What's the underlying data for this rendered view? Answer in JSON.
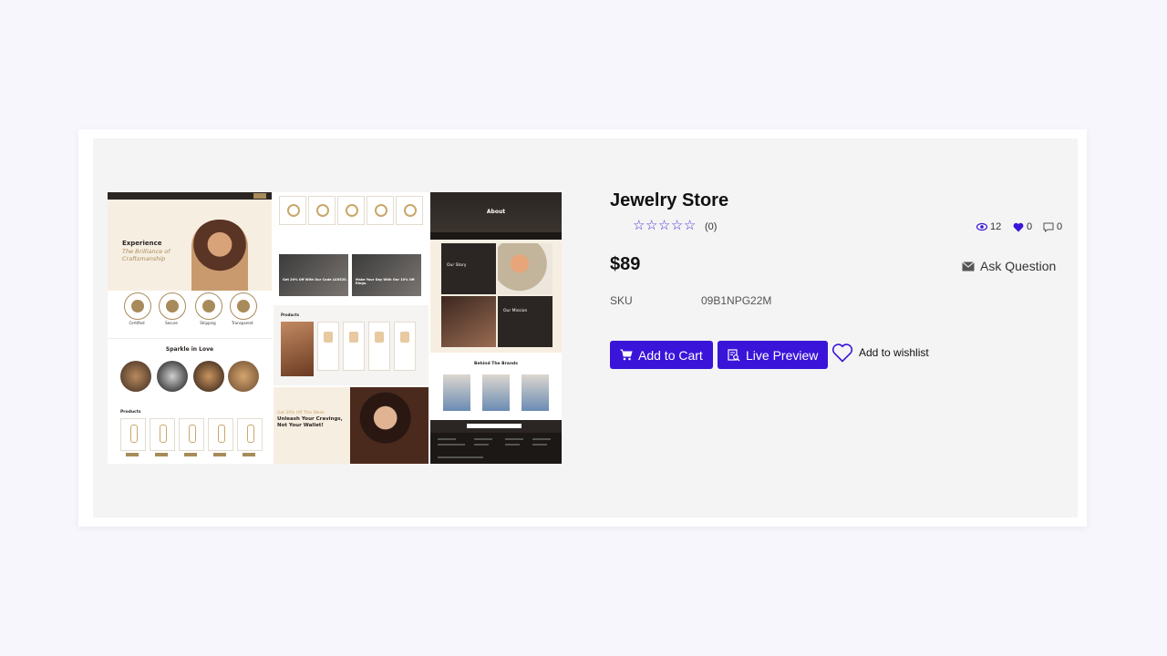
{
  "product": {
    "title": "Jewelry Store",
    "rating_count": "(0)",
    "views": "12",
    "likes": "0",
    "comments": "0",
    "price": "$89",
    "ask_label": "Ask Question",
    "sku_label": "SKU",
    "sku_value": "09B1NPG22M",
    "add_to_cart": "Add to Cart",
    "live_preview": "Live Preview",
    "wishlist": "Add to wishlist"
  },
  "preview": {
    "hero_title": "Experience",
    "hero_sub": "The Brilliance of Craftsmanship",
    "features": [
      "Certified",
      "Secure",
      "Shipping",
      "Transparent"
    ],
    "sparkle_title": "Sparkle in Love",
    "products_title": "Products",
    "promo1": "Get 20% Off With Our Code LUXE20.",
    "promo2": "Make Your Day With Our 10% Off Rings.",
    "offer_small": "Get 20% Off This Week",
    "offer_big": "Unleash Your Cravings, Not Your Wallet!",
    "about": "About",
    "our_story": "Our Story",
    "our_mission": "Our Mission",
    "behind_brands": "Behind The Brands"
  },
  "colors": {
    "accent": "#3a14d9",
    "gold": "#a88b5a",
    "dark": "#2b2623"
  }
}
